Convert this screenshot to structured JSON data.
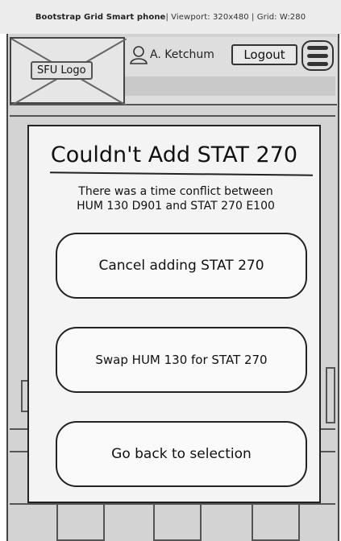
{
  "topbar": {
    "bold_text": "Bootstrap Grid Smart phone",
    "detail_text": " | Viewport: 320x480 | Grid: W:280"
  },
  "header": {
    "logo_label": "SFU Logo",
    "user_name": "A. Ketchum",
    "logout_label": "Logout"
  },
  "icons": {
    "user": "user-icon",
    "menu": "hamburger-menu-icon"
  },
  "modal": {
    "title": "Couldn't Add STAT 270",
    "message_line1": "There was a time conflict between",
    "message_line2": "HUM 130 D901 and STAT 270 E100",
    "options": [
      "Cancel adding STAT 270",
      "Swap HUM 130 for STAT 270",
      "Go back to selection"
    ]
  },
  "colors": {
    "page_background": "#d3d3d3",
    "modal_background": "#f4f4f4",
    "border": "#222222"
  }
}
